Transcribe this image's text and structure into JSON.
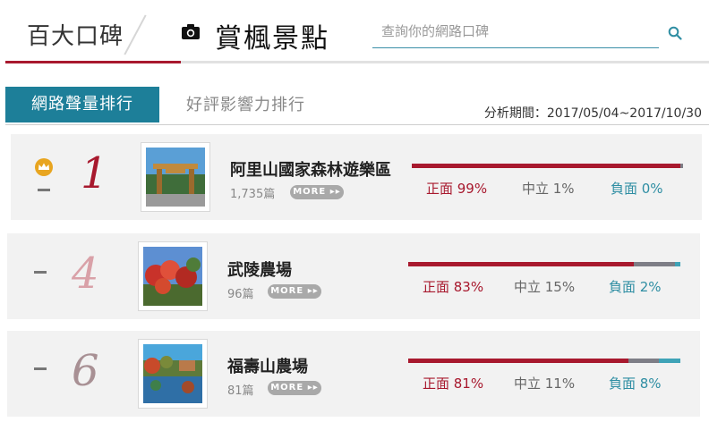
{
  "header": {
    "brand": "百大口碑",
    "topic": "賞楓景點",
    "search_placeholder": "查詢你的網路口碑",
    "camera_icon": "camera-icon",
    "search_icon": "search-icon"
  },
  "tabs": {
    "active": "網路聲量排行",
    "inactive": "好評影響力排行"
  },
  "period": "分析期間：2017/05/04~2017/10/30",
  "more_label": "MORE ▸▸",
  "colors": {
    "accent": "#a8192e",
    "teal": "#1d7f99",
    "neutral": "#7e7e86",
    "negative": "#3fa3b7"
  },
  "rankings": [
    {
      "rank": "1",
      "trend": "-",
      "crown": true,
      "name": "阿里山國家森林遊樂區",
      "count": "1,735篇",
      "positive": 99,
      "neutral": 1,
      "negative": 0,
      "positive_label": "正面 99%",
      "neutral_label": "中立 1%",
      "negative_label": "負面 0%"
    },
    {
      "rank": "4",
      "trend": "-",
      "crown": false,
      "name": "武陵農場",
      "count": "96篇",
      "positive": 83,
      "neutral": 15,
      "negative": 2,
      "positive_label": "正面 83%",
      "neutral_label": "中立 15%",
      "negative_label": "負面 2%"
    },
    {
      "rank": "6",
      "trend": "-",
      "crown": false,
      "name": "福壽山農場",
      "count": "81篇",
      "positive": 81,
      "neutral": 11,
      "negative": 8,
      "positive_label": "正面 81%",
      "neutral_label": "中立 11%",
      "negative_label": "負面 8%"
    }
  ]
}
